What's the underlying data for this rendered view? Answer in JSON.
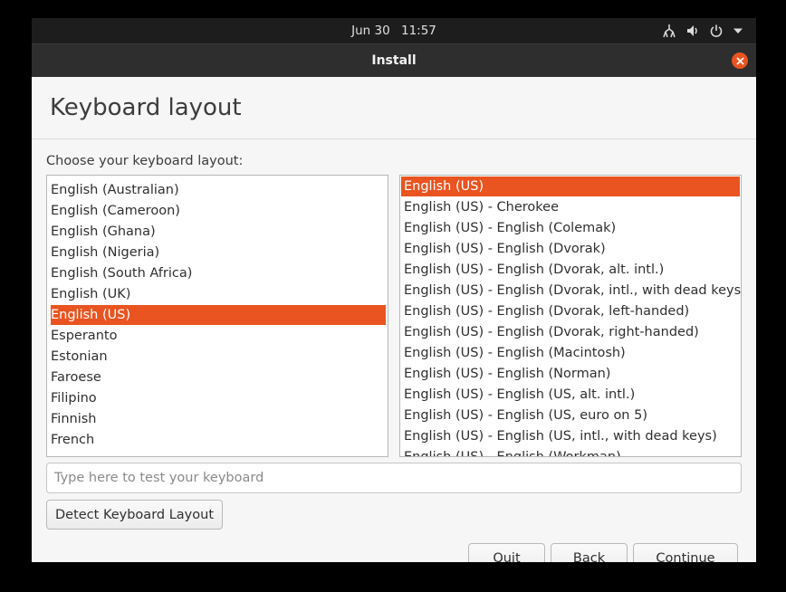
{
  "topbar": {
    "date": "Jun 30",
    "time": "11:57"
  },
  "window": {
    "title": "Install"
  },
  "page": {
    "title": "Keyboard layout",
    "prompt": "Choose your keyboard layout:"
  },
  "layouts": [
    "English (Australian)",
    "English (Cameroon)",
    "English (Ghana)",
    "English (Nigeria)",
    "English (South Africa)",
    "English (UK)",
    "English (US)",
    "Esperanto",
    "Estonian",
    "Faroese",
    "Filipino",
    "Finnish",
    "French"
  ],
  "layouts_selected": "English (US)",
  "variants": [
    "English (US)",
    "English (US) - Cherokee",
    "English (US) - English (Colemak)",
    "English (US) - English (Dvorak)",
    "English (US) - English (Dvorak, alt. intl.)",
    "English (US) - English (Dvorak, intl., with dead keys)",
    "English (US) - English (Dvorak, left-handed)",
    "English (US) - English (Dvorak, right-handed)",
    "English (US) - English (Macintosh)",
    "English (US) - English (Norman)",
    "English (US) - English (US, alt. intl.)",
    "English (US) - English (US, euro on 5)",
    "English (US) - English (US, intl., with dead keys)",
    "English (US) - English (Workman)"
  ],
  "variants_selected": "English (US)",
  "test_field": {
    "placeholder": "Type here to test your keyboard",
    "value": ""
  },
  "buttons": {
    "detect": "Detect Keyboard Layout",
    "quit": "Quit",
    "back": "Back",
    "continue": "Continue"
  },
  "colors": {
    "accent": "#e95420",
    "titlebar": "#2e2e2e",
    "topbar": "#1d1d1d"
  },
  "icons": {
    "tray": [
      "network-icon",
      "volume-icon",
      "power-icon",
      "chevron-down-icon"
    ],
    "close": "close-icon"
  }
}
